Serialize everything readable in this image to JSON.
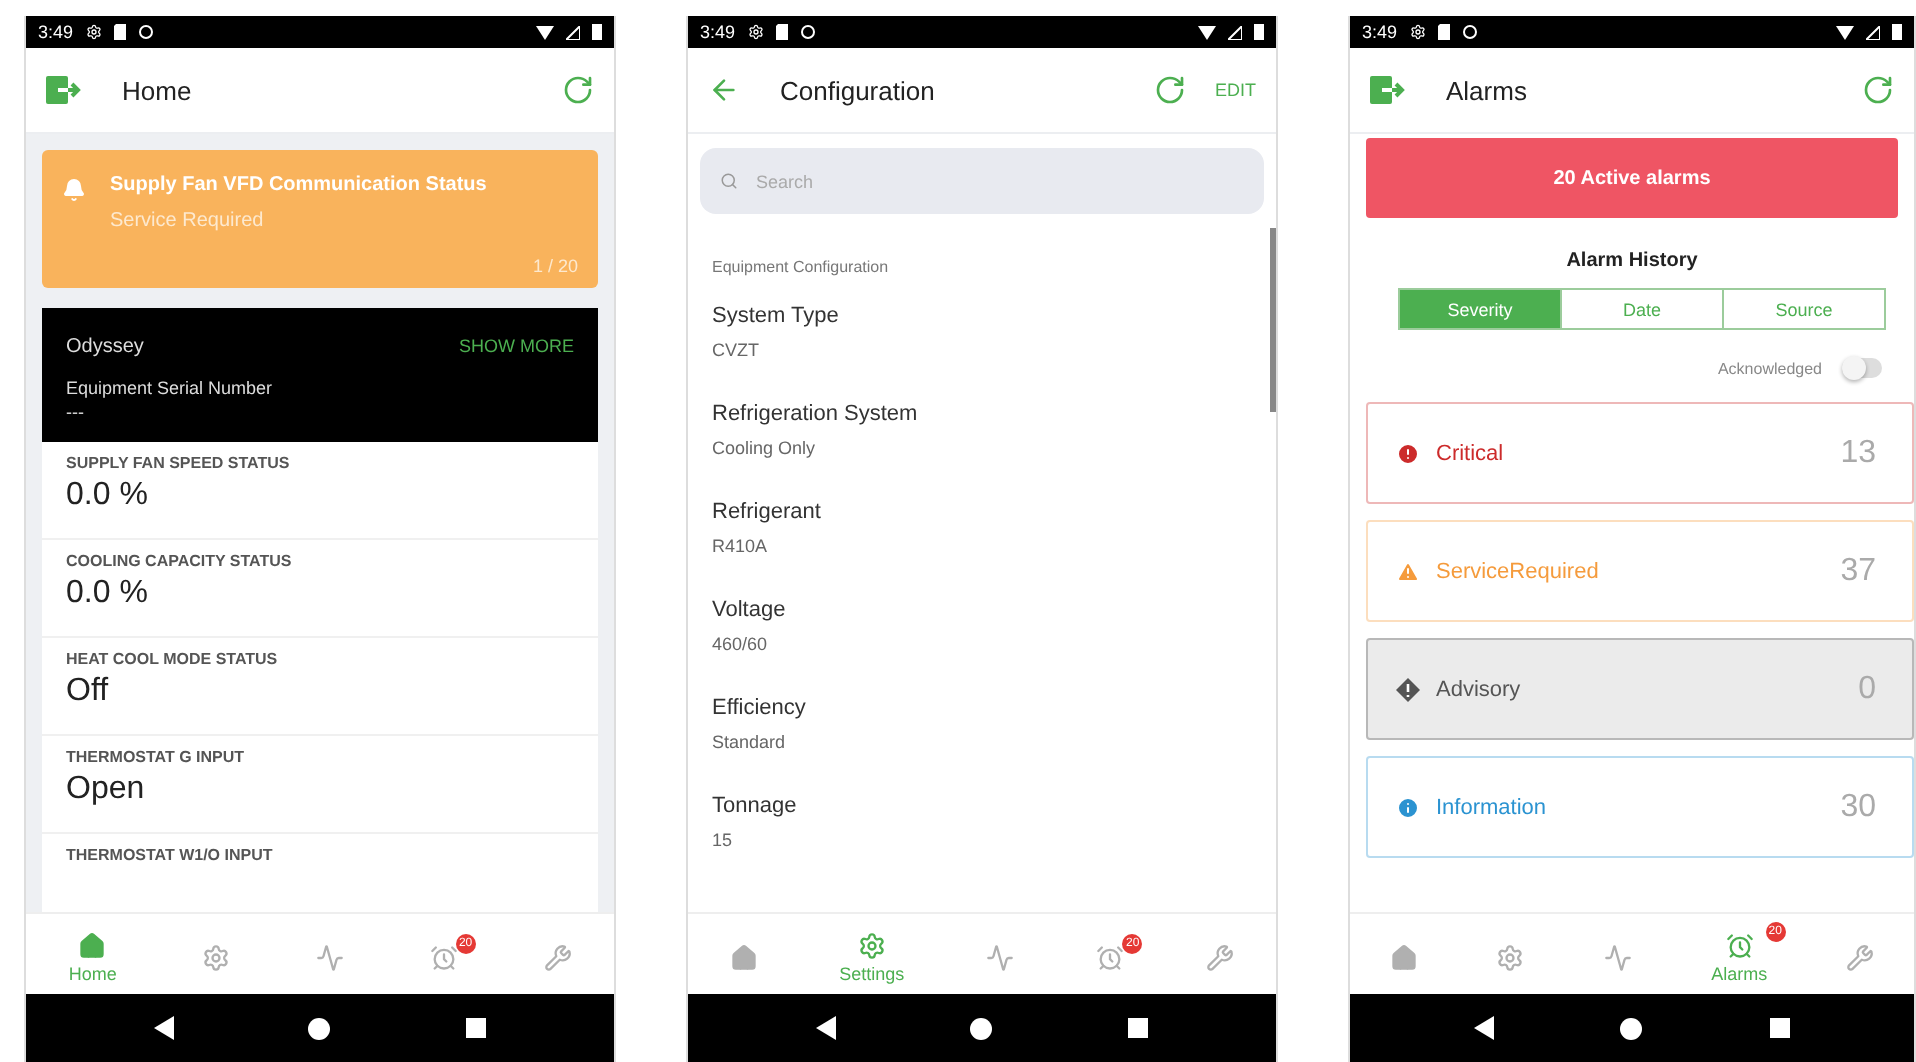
{
  "screens": [
    {
      "kind": "home",
      "status_time": "3:49",
      "title": "Home",
      "alert": {
        "title": "Supply Fan VFD Communication Status",
        "subtitle": "Service Required",
        "counter": "1 / 20"
      },
      "equipment": {
        "name": "Odyssey",
        "action": "SHOW MORE",
        "serial_label": "Equipment Serial Number",
        "serial_value": "---"
      },
      "points": [
        {
          "label": "SUPPLY FAN SPEED STATUS",
          "value": "0.0 %"
        },
        {
          "label": "COOLING CAPACITY STATUS",
          "value": "0.0 %"
        },
        {
          "label": "HEAT COOL MODE STATUS",
          "value": "Off"
        },
        {
          "label": "THERMOSTAT G INPUT",
          "value": "Open"
        },
        {
          "label": "THERMOSTAT W1/O INPUT"
        }
      ],
      "nav": [
        {
          "kind": "home",
          "selected": true,
          "label": "Home"
        },
        {
          "kind": "settings",
          "selected": false
        },
        {
          "kind": "trend",
          "selected": false
        },
        {
          "kind": "alarm",
          "selected": false,
          "badge": "20"
        },
        {
          "kind": "tools",
          "selected": false
        }
      ]
    },
    {
      "kind": "configuration",
      "status_time": "3:49",
      "title": "Configuration",
      "action": "EDIT",
      "search": {
        "placeholder": "Search"
      },
      "section": "Equipment Configuration",
      "fields": [
        {
          "label": "System Type",
          "value": "CVZT"
        },
        {
          "label": "Refrigeration System",
          "value": "Cooling Only"
        },
        {
          "label": "Refrigerant",
          "value": "R410A"
        },
        {
          "label": "Voltage",
          "value": "460/60"
        },
        {
          "label": "Efficiency",
          "value": "Standard"
        },
        {
          "label": "Tonnage",
          "value": "15"
        }
      ],
      "nav": [
        {
          "kind": "home",
          "selected": false
        },
        {
          "kind": "settings",
          "selected": true,
          "label": "Settings"
        },
        {
          "kind": "trend",
          "selected": false
        },
        {
          "kind": "alarm",
          "selected": false,
          "badge": "20"
        },
        {
          "kind": "tools",
          "selected": false
        }
      ]
    },
    {
      "kind": "alarms",
      "status_time": "3:49",
      "title": "Alarms",
      "banner": "20 Active alarms",
      "history_title": "Alarm History",
      "tabs": [
        {
          "label": "Severity",
          "selected": true
        },
        {
          "label": "Date",
          "selected": false
        },
        {
          "label": "Source",
          "selected": false
        }
      ],
      "toggle": {
        "label": "Acknowledged",
        "on": false
      },
      "severities": [
        {
          "kind": "critical",
          "label": "Critical",
          "count": "13",
          "color": "#cc2b2b"
        },
        {
          "kind": "service",
          "label": "ServiceRequired",
          "count": "37",
          "color": "#f59b3c"
        },
        {
          "kind": "advisory",
          "label": "Advisory",
          "count": "0",
          "color": "#555555"
        },
        {
          "kind": "information",
          "label": "Information",
          "count": "30",
          "color": "#2b93d1"
        }
      ],
      "nav": [
        {
          "kind": "home",
          "selected": false
        },
        {
          "kind": "settings",
          "selected": false
        },
        {
          "kind": "trend",
          "selected": false
        },
        {
          "kind": "alarm",
          "selected": true,
          "label": "Alarms",
          "badge": "20"
        },
        {
          "kind": "tools",
          "selected": false
        }
      ]
    }
  ]
}
